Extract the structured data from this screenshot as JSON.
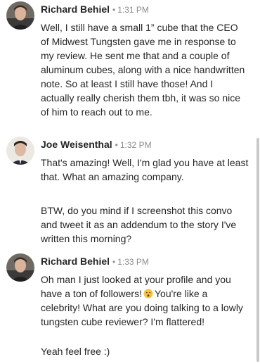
{
  "messages": [
    {
      "sender": "Richard Behiel",
      "time": "1:31 PM",
      "paragraphs": [
        "Well, I still have a small 1” cube that the CEO of Midwest Tungsten gave me in response to my review. He sent me that and a couple of aluminum cubes, along with a nice handwritten note. So at least I still have those! And I actually really cherish them tbh, it was so nice of him to reach out to me."
      ]
    },
    {
      "sender": "Joe Weisenthal",
      "time": "1:32 PM",
      "paragraphs": [
        "That's amazing! Well, I'm glad you have at least that. What an amazing company.",
        "BTW, do you mind if I screenshot this convo and tweet it as an addendum to the story I've written this morning?"
      ]
    },
    {
      "sender": "Richard Behiel",
      "time": "1:33 PM",
      "paragraphs": [
        "Oh man I just looked at your profile and you have a ton of followers!",
        "You're like a celebrity! What are you doing talking to a lowly tungsten cube reviewer? I'm flattered!",
        "Yeah feel free :)"
      ]
    }
  ],
  "separator": "•",
  "icons": {
    "emoji": "hushed-face-icon"
  }
}
